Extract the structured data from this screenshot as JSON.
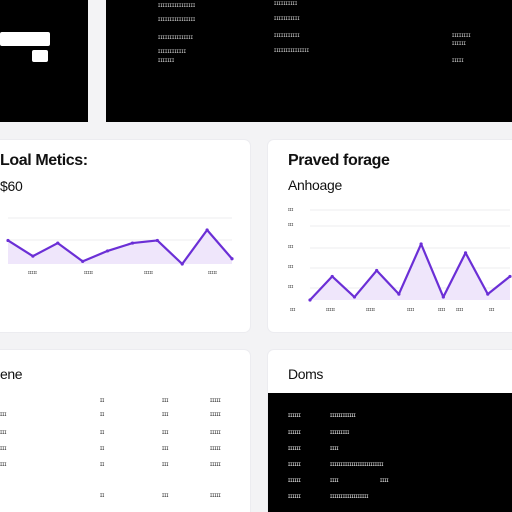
{
  "top_left": {
    "rows": [
      "",
      "",
      ""
    ]
  },
  "top_right": {
    "col1": [
      "ɪɪɪɪɪɪɪɪɪɪɪɪɪɪɪɪ",
      "ɪɪɪɪɪɪɪɪɪɪɪɪɪɪɪɪ",
      "ɪɪɪɪɪɪɪɪɪɪɪɪɪɪɪ",
      "ɪɪɪɪɪɪɪɪɪɪɪɪ",
      "ɪɪɪɪɪɪɪ"
    ],
    "col2": [
      "ɪɪɪɪɪɪɪɪɪɪ",
      "ɪɪɪɪɪɪɪɪɪɪɪ",
      "ɪɪɪɪɪɪɪɪɪɪɪ",
      "ɪɪɪɪɪɪɪɪɪɪɪɪɪɪɪ"
    ],
    "col3": [
      "ɪɪɪɪɪɪɪɪ",
      "ɪɪɪɪɪɪ",
      "ɪɪɪɪɪ"
    ]
  },
  "load_metrics": {
    "title": "Loal Metics:",
    "value": "$60",
    "x_ticks": [
      "ɪɪɪɪɪ",
      "ɪɪɪɪɪ",
      "ɪɪɪɪɪ",
      "ɪɪɪɪɪ"
    ]
  },
  "paved_storage": {
    "title": "Praved forage",
    "subtitle": "Anhoage",
    "y_ticks": [
      "ɪɪɪ",
      "ɪɪɪ",
      "ɪɪɪ",
      "ɪɪɪ",
      "ɪɪɪ"
    ],
    "x_ticks": [
      "ɪɪɪ",
      "ɪɪɪɪɪ",
      "ɪɪɪɪɪ",
      "ɪɪɪɪ",
      "ɪɪɪɪ",
      "ɪɪɪɪ",
      "ɪɪɪ"
    ]
  },
  "bottom_left": {
    "title": "ene",
    "rows": [
      {
        "c1": "",
        "c2": "ɪɪ",
        "c3": "ɪɪɪ",
        "c4": "ɪɪɪɪɪ"
      },
      {
        "c1": "ɪɪɪ",
        "c2": "ɪɪ",
        "c3": "ɪɪɪ",
        "c4": "ɪɪɪɪɪ"
      },
      {
        "c1": "ɪɪɪ",
        "c2": "ɪɪ",
        "c3": "ɪɪɪ",
        "c4": "ɪɪɪɪɪ"
      },
      {
        "c1": "ɪɪɪ",
        "c2": "ɪɪ",
        "c3": "ɪɪɪ",
        "c4": "ɪɪɪɪɪ"
      },
      {
        "c1": "ɪɪɪ",
        "c2": "ɪɪ",
        "c3": "ɪɪɪ",
        "c4": "ɪɪɪɪɪ"
      },
      {
        "c1": "",
        "c2": "ɪɪ",
        "c3": "ɪɪɪ",
        "c4": "ɪɪɪɪɪ"
      }
    ]
  },
  "bottom_right": {
    "title": "Doms",
    "rows": [
      {
        "c1": "ɪɪɪɪɪɪ",
        "c2": "ɪɪɪɪɪɪɪɪɪɪɪɪ",
        "c3": ""
      },
      {
        "c1": "ɪɪɪɪɪɪ",
        "c2": "ɪɪɪɪɪɪɪɪɪ",
        "c3": ""
      },
      {
        "c1": "ɪɪɪɪɪɪ",
        "c2": "ɪɪɪɪ",
        "c3": ""
      },
      {
        "c1": "ɪɪɪɪɪɪ",
        "c2": "ɪɪɪɪɪɪɪɪɪɪɪɪɪɪɪɪɪɪɪɪɪɪɪɪɪ",
        "c3": ""
      },
      {
        "c1": "ɪɪɪɪɪɪ",
        "c2": "ɪɪɪɪ",
        "c3": "ɪɪɪɪ"
      },
      {
        "c1": "ɪɪɪɪɪɪ",
        "c2": "ɪɪɪɪɪɪɪɪɪɪɪɪɪɪɪɪɪɪ",
        "c3": ""
      }
    ]
  },
  "colors": {
    "accent": "#6b2fd6",
    "fill": "#efe6fb"
  },
  "chart_data": [
    {
      "type": "line",
      "series": [
        {
          "values": [
            10,
            4,
            9,
            2,
            6,
            9,
            10,
            1,
            14,
            3
          ]
        }
      ]
    },
    {
      "type": "line",
      "series": [
        {
          "values": [
            2,
            10,
            3,
            12,
            4,
            21,
            3,
            18,
            4,
            10
          ]
        }
      ]
    }
  ]
}
